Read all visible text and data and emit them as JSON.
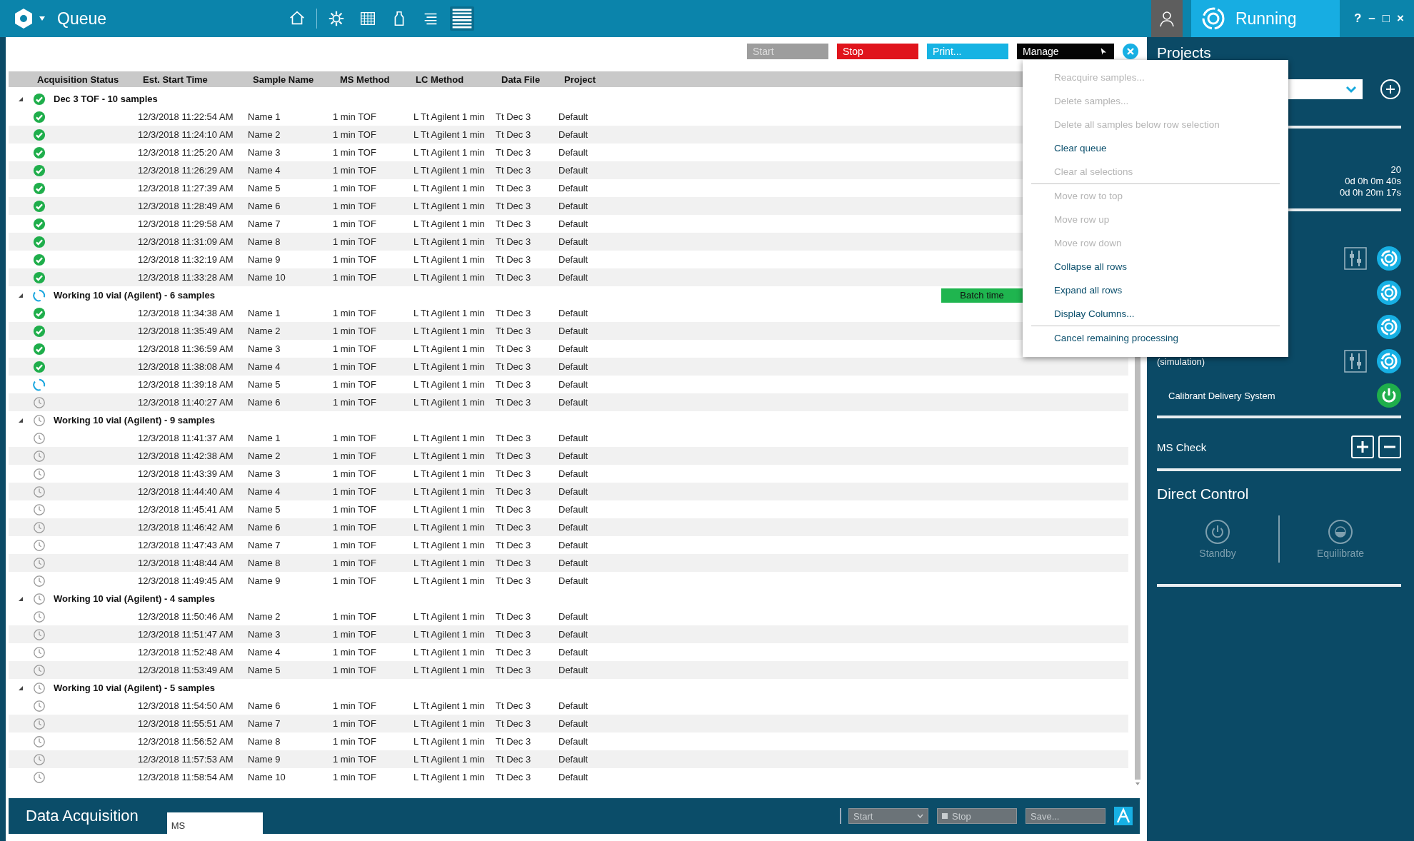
{
  "title_bar": {
    "title": "Queue",
    "nav_icons": [
      {
        "kind": "home",
        "selected": false
      },
      {
        "kind": "gear",
        "selected": false
      },
      {
        "kind": "grid",
        "selected": false
      },
      {
        "kind": "bottle",
        "selected": false
      },
      {
        "kind": "list",
        "selected": false
      },
      {
        "kind": "stack",
        "selected": true
      }
    ],
    "status": "Running",
    "window_controls": [
      "?",
      "–",
      "□",
      "×"
    ]
  },
  "toolbar": {
    "buttons": [
      {
        "kind": "start",
        "label": "Start",
        "disabled": true
      },
      {
        "kind": "stop",
        "label": "Stop",
        "disabled": false
      },
      {
        "kind": "print",
        "label": "Print...",
        "disabled": false
      },
      {
        "kind": "manage",
        "label": "Manage",
        "disabled": false
      }
    ]
  },
  "table": {
    "columns": [
      "Acquisition Status",
      "Est. Start Time",
      "Sample Name",
      "MS Method",
      "LC Method",
      "Data File",
      "Project"
    ],
    "groups": [
      {
        "label": "Dec 3 TOF - 10 samples",
        "kind": "done",
        "expanded": true,
        "samples": [
          {
            "kind": "done",
            "time": "12/3/2018 11:22:54 AM",
            "name": "Name 1",
            "ms_method": "1 min TOF",
            "lc_method": "L Tt Agilent 1 min",
            "data_file": "Tt Dec 3",
            "project": "Default"
          },
          {
            "kind": "done",
            "time": "12/3/2018 11:24:10 AM",
            "name": "Name 2",
            "ms_method": "1 min TOF",
            "lc_method": "L Tt Agilent 1 min",
            "data_file": "Tt Dec 3",
            "project": "Default"
          },
          {
            "kind": "done",
            "time": "12/3/2018 11:25:20 AM",
            "name": "Name 3",
            "ms_method": "1 min TOF",
            "lc_method": "L Tt Agilent 1 min",
            "data_file": "Tt Dec 3",
            "project": "Default"
          },
          {
            "kind": "done",
            "time": "12/3/2018 11:26:29 AM",
            "name": "Name 4",
            "ms_method": "1 min TOF",
            "lc_method": "L Tt Agilent 1 min",
            "data_file": "Tt Dec 3",
            "project": "Default"
          },
          {
            "kind": "done",
            "time": "12/3/2018 11:27:39 AM",
            "name": "Name 5",
            "ms_method": "1 min TOF",
            "lc_method": "L Tt Agilent 1 min",
            "data_file": "Tt Dec 3",
            "project": "Default"
          },
          {
            "kind": "done",
            "time": "12/3/2018 11:28:49 AM",
            "name": "Name 6",
            "ms_method": "1 min TOF",
            "lc_method": "L Tt Agilent 1 min",
            "data_file": "Tt Dec 3",
            "project": "Default"
          },
          {
            "kind": "done",
            "time": "12/3/2018 11:29:58 AM",
            "name": "Name 7",
            "ms_method": "1 min TOF",
            "lc_method": "L Tt Agilent 1 min",
            "data_file": "Tt Dec 3",
            "project": "Default"
          },
          {
            "kind": "done",
            "time": "12/3/2018 11:31:09 AM",
            "name": "Name 8",
            "ms_method": "1 min TOF",
            "lc_method": "L Tt Agilent 1 min",
            "data_file": "Tt Dec 3",
            "project": "Default"
          },
          {
            "kind": "done",
            "time": "12/3/2018 11:32:19 AM",
            "name": "Name 9",
            "ms_method": "1 min TOF",
            "lc_method": "L Tt Agilent 1 min",
            "data_file": "Tt Dec 3",
            "project": "Default"
          },
          {
            "kind": "done",
            "time": "12/3/2018 11:33:28 AM",
            "name": "Name 10",
            "ms_method": "1 min TOF",
            "lc_method": "L Tt Agilent 1 min",
            "data_file": "Tt Dec 3",
            "project": "Default"
          }
        ]
      },
      {
        "label": "Working 10 vial (Agilent) - 6 samples",
        "kind": "running",
        "expanded": true,
        "badge": "Batch time",
        "samples": [
          {
            "kind": "done",
            "time": "12/3/2018 11:34:38 AM",
            "name": "Name 1",
            "ms_method": "1 min TOF",
            "lc_method": "L Tt Agilent 1 min",
            "data_file": "Tt Dec 3",
            "project": "Default"
          },
          {
            "kind": "done",
            "time": "12/3/2018 11:35:49 AM",
            "name": "Name 2",
            "ms_method": "1 min TOF",
            "lc_method": "L Tt Agilent 1 min",
            "data_file": "Tt Dec 3",
            "project": "Default"
          },
          {
            "kind": "done",
            "time": "12/3/2018 11:36:59 AM",
            "name": "Name 3",
            "ms_method": "1 min TOF",
            "lc_method": "L Tt Agilent 1 min",
            "data_file": "Tt Dec 3",
            "project": "Default"
          },
          {
            "kind": "done",
            "time": "12/3/2018 11:38:08 AM",
            "name": "Name 4",
            "ms_method": "1 min TOF",
            "lc_method": "L Tt Agilent 1 min",
            "data_file": "Tt Dec 3",
            "project": "Default"
          },
          {
            "kind": "running",
            "time": "12/3/2018 11:39:18 AM",
            "name": "Name 5",
            "ms_method": "1 min TOF",
            "lc_method": "L Tt Agilent 1 min",
            "data_file": "Tt Dec 3",
            "project": "Default"
          },
          {
            "kind": "waiting",
            "time": "12/3/2018 11:40:27 AM",
            "name": "Name 6",
            "ms_method": "1 min TOF",
            "lc_method": "L Tt Agilent 1 min",
            "data_file": "Tt Dec 3",
            "project": "Default"
          }
        ]
      },
      {
        "label": "Working 10 vial (Agilent) - 9 samples",
        "kind": "waiting",
        "expanded": true,
        "samples": [
          {
            "kind": "waiting",
            "time": "12/3/2018 11:41:37 AM",
            "name": "Name 1",
            "ms_method": "1 min TOF",
            "lc_method": "L Tt Agilent 1 min",
            "data_file": "Tt Dec 3",
            "project": "Default"
          },
          {
            "kind": "waiting",
            "time": "12/3/2018 11:42:38 AM",
            "name": "Name 2",
            "ms_method": "1 min TOF",
            "lc_method": "L Tt Agilent 1 min",
            "data_file": "Tt Dec 3",
            "project": "Default"
          },
          {
            "kind": "waiting",
            "time": "12/3/2018 11:43:39 AM",
            "name": "Name 3",
            "ms_method": "1 min TOF",
            "lc_method": "L Tt Agilent 1 min",
            "data_file": "Tt Dec 3",
            "project": "Default"
          },
          {
            "kind": "waiting",
            "time": "12/3/2018 11:44:40 AM",
            "name": "Name 4",
            "ms_method": "1 min TOF",
            "lc_method": "L Tt Agilent 1 min",
            "data_file": "Tt Dec 3",
            "project": "Default"
          },
          {
            "kind": "waiting",
            "time": "12/3/2018 11:45:41 AM",
            "name": "Name 5",
            "ms_method": "1 min TOF",
            "lc_method": "L Tt Agilent 1 min",
            "data_file": "Tt Dec 3",
            "project": "Default"
          },
          {
            "kind": "waiting",
            "time": "12/3/2018 11:46:42 AM",
            "name": "Name 6",
            "ms_method": "1 min TOF",
            "lc_method": "L Tt Agilent 1 min",
            "data_file": "Tt Dec 3",
            "project": "Default"
          },
          {
            "kind": "waiting",
            "time": "12/3/2018 11:47:43 AM",
            "name": "Name 7",
            "ms_method": "1 min TOF",
            "lc_method": "L Tt Agilent 1 min",
            "data_file": "Tt Dec 3",
            "project": "Default"
          },
          {
            "kind": "waiting",
            "time": "12/3/2018 11:48:44 AM",
            "name": "Name 8",
            "ms_method": "1 min TOF",
            "lc_method": "L Tt Agilent 1 min",
            "data_file": "Tt Dec 3",
            "project": "Default"
          },
          {
            "kind": "waiting",
            "time": "12/3/2018 11:49:45 AM",
            "name": "Name 9",
            "ms_method": "1 min TOF",
            "lc_method": "L Tt Agilent 1 min",
            "data_file": "Tt Dec 3",
            "project": "Default"
          }
        ]
      },
      {
        "label": "Working 10 vial (Agilent) - 4 samples",
        "kind": "waiting",
        "expanded": true,
        "samples": [
          {
            "kind": "waiting",
            "time": "12/3/2018 11:50:46 AM",
            "name": "Name 2",
            "ms_method": "1 min TOF",
            "lc_method": "L Tt Agilent 1 min",
            "data_file": "Tt Dec 3",
            "project": "Default"
          },
          {
            "kind": "waiting",
            "time": "12/3/2018 11:51:47 AM",
            "name": "Name 3",
            "ms_method": "1 min TOF",
            "lc_method": "L Tt Agilent 1 min",
            "data_file": "Tt Dec 3",
            "project": "Default"
          },
          {
            "kind": "waiting",
            "time": "12/3/2018 11:52:48 AM",
            "name": "Name 4",
            "ms_method": "1 min TOF",
            "lc_method": "L Tt Agilent 1 min",
            "data_file": "Tt Dec 3",
            "project": "Default"
          },
          {
            "kind": "waiting",
            "time": "12/3/2018 11:53:49 AM",
            "name": "Name 5",
            "ms_method": "1 min TOF",
            "lc_method": "L Tt Agilent 1 min",
            "data_file": "Tt Dec 3",
            "project": "Default"
          }
        ]
      },
      {
        "label": "Working 10 vial (Agilent) - 5 samples",
        "kind": "waiting",
        "expanded": true,
        "samples": [
          {
            "kind": "waiting",
            "time": "12/3/2018 11:54:50 AM",
            "name": "Name 6",
            "ms_method": "1 min TOF",
            "lc_method": "L Tt Agilent 1 min",
            "data_file": "Tt Dec 3",
            "project": "Default"
          },
          {
            "kind": "waiting",
            "time": "12/3/2018 11:55:51 AM",
            "name": "Name 7",
            "ms_method": "1 min TOF",
            "lc_method": "L Tt Agilent 1 min",
            "data_file": "Tt Dec 3",
            "project": "Default"
          },
          {
            "kind": "waiting",
            "time": "12/3/2018 11:56:52 AM",
            "name": "Name 8",
            "ms_method": "1 min TOF",
            "lc_method": "L Tt Agilent 1 min",
            "data_file": "Tt Dec 3",
            "project": "Default"
          },
          {
            "kind": "waiting",
            "time": "12/3/2018 11:57:53 AM",
            "name": "Name 9",
            "ms_method": "1 min TOF",
            "lc_method": "L Tt Agilent 1 min",
            "data_file": "Tt Dec 3",
            "project": "Default"
          },
          {
            "kind": "waiting",
            "time": "12/3/2018 11:58:54 AM",
            "name": "Name 10",
            "ms_method": "1 min TOF",
            "lc_method": "L Tt Agilent 1 min",
            "data_file": "Tt Dec 3",
            "project": "Default"
          }
        ]
      }
    ]
  },
  "menu": {
    "sections": [
      {
        "items": [
          {
            "label": "Reacquire samples...",
            "disabled": true
          },
          {
            "label": "Delete samples...",
            "disabled": true
          },
          {
            "label": "Delete all samples below row selection",
            "disabled": true
          },
          {
            "label": "Clear queue",
            "disabled": false
          },
          {
            "label": "Clear al selections",
            "disabled": true
          }
        ]
      },
      {
        "items": [
          {
            "label": "Move row to top",
            "disabled": true
          },
          {
            "label": "Move row up",
            "disabled": true
          },
          {
            "label": "Move row down",
            "disabled": true
          },
          {
            "label": "Collapse all rows",
            "disabled": false
          },
          {
            "label": "Expand all rows",
            "disabled": false
          },
          {
            "label": "Display Columns...",
            "disabled": false
          }
        ]
      },
      {
        "items": [
          {
            "label": "Cancel remaining processing",
            "disabled": false
          }
        ]
      }
    ]
  },
  "bottom_bar": {
    "title": "Data Acquisition",
    "field": {
      "value": "MS"
    },
    "controls": [
      {
        "kind": "dropdown",
        "label": "Start"
      },
      {
        "kind": "stop",
        "label": "Stop"
      },
      {
        "kind": "button",
        "label": "Save..."
      }
    ]
  },
  "panel": {
    "title": "Projects",
    "stats": [
      "20",
      "0d 0h 0m 40s",
      "0d 0h 20m 17s"
    ],
    "devices": [
      {
        "tune_button": true,
        "kind": "ready"
      },
      {
        "tune_button": false,
        "kind": "ready"
      },
      {
        "tune_button": false,
        "kind": "ready"
      },
      {
        "label": "(simulation)",
        "tune_button": true,
        "kind": "ready"
      },
      {
        "label": "Calibrant Delivery System",
        "tune_button": false,
        "kind": "on"
      }
    ],
    "ms_check": "MS Check",
    "direct_control": {
      "title": "Direct Control",
      "actions": [
        {
          "kind": "standby",
          "label": "Standby",
          "disabled": true
        },
        {
          "kind": "equilibrate",
          "label": "Equilibrate",
          "disabled": true
        }
      ]
    }
  }
}
